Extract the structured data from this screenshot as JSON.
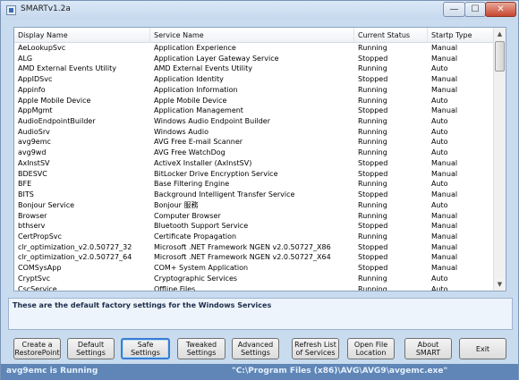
{
  "window": {
    "title": "SMARTv1.2a",
    "min": "—",
    "max": "☐",
    "close": "✕"
  },
  "columns": [
    "Display Name",
    "Service Name",
    "Current Status",
    "Startp Type"
  ],
  "rows": [
    [
      "AeLookupSvc",
      "Application Experience",
      "Running",
      "Manual"
    ],
    [
      "ALG",
      "Application Layer Gateway Service",
      "Stopped",
      "Manual"
    ],
    [
      "AMD External Events Utility",
      "AMD External Events Utility",
      "Running",
      "Auto"
    ],
    [
      "AppIDSvc",
      "Application Identity",
      "Stopped",
      "Manual"
    ],
    [
      "Appinfo",
      "Application Information",
      "Running",
      "Manual"
    ],
    [
      "Apple Mobile Device",
      "Apple Mobile Device",
      "Running",
      "Auto"
    ],
    [
      "AppMgmt",
      "Application Management",
      "Stopped",
      "Manual"
    ],
    [
      "AudioEndpointBuilder",
      "Windows Audio Endpoint Builder",
      "Running",
      "Auto"
    ],
    [
      "AudioSrv",
      "Windows Audio",
      "Running",
      "Auto"
    ],
    [
      "avg9emc",
      "AVG Free E-mail Scanner",
      "Running",
      "Auto"
    ],
    [
      "avg9wd",
      "AVG Free WatchDog",
      "Running",
      "Auto"
    ],
    [
      "AxInstSV",
      "ActiveX Installer (AxInstSV)",
      "Stopped",
      "Manual"
    ],
    [
      "BDESVC",
      "BitLocker Drive Encryption Service",
      "Stopped",
      "Manual"
    ],
    [
      "BFE",
      "Base Filtering Engine",
      "Running",
      "Auto"
    ],
    [
      "BITS",
      "Background Intelligent Transfer Service",
      "Stopped",
      "Manual"
    ],
    [
      "Bonjour Service",
      "Bonjour 服務",
      "Running",
      "Auto"
    ],
    [
      "Browser",
      "Computer Browser",
      "Running",
      "Manual"
    ],
    [
      "bthserv",
      "Bluetooth Support Service",
      "Stopped",
      "Manual"
    ],
    [
      "CertPropSvc",
      "Certificate Propagation",
      "Running",
      "Manual"
    ],
    [
      "clr_optimization_v2.0.50727_32",
      "Microsoft .NET Framework NGEN v2.0.50727_X86",
      "Stopped",
      "Manual"
    ],
    [
      "clr_optimization_v2.0.50727_64",
      "Microsoft .NET Framework NGEN v2.0.50727_X64",
      "Stopped",
      "Manual"
    ],
    [
      "COMSysApp",
      "COM+ System Application",
      "Stopped",
      "Manual"
    ],
    [
      "CryptSvc",
      "Cryptographic Services",
      "Running",
      "Auto"
    ],
    [
      "CscService",
      "Offline Files",
      "Running",
      "Auto"
    ]
  ],
  "description": "These are the default factory settings for the Windows Services",
  "buttons": [
    {
      "id": "create-restorepoint",
      "line1": "Create a",
      "line2": "RestorePoint"
    },
    {
      "id": "default-settings",
      "line1": "Default",
      "line2": "Settings"
    },
    {
      "id": "safe-settings",
      "line1": "Safe Settings",
      "line2": ""
    },
    {
      "id": "tweaked-settings",
      "line1": "Tweaked",
      "line2": "Settings"
    },
    {
      "id": "advanced-settings",
      "line1": "Advanced",
      "line2": "Settings"
    },
    {
      "id": "refresh-list",
      "line1": "Refresh List",
      "line2": "of Services"
    },
    {
      "id": "open-file-location",
      "line1": "Open File",
      "line2": "Location"
    },
    {
      "id": "about-smart",
      "line1": "About",
      "line2": "SMART"
    },
    {
      "id": "exit",
      "line1": "Exit",
      "line2": ""
    }
  ],
  "status": {
    "left": "avg9emc is Running",
    "right": "\"C:\\Program Files (x86)\\AVG\\AVG9\\avgemc.exe\""
  }
}
